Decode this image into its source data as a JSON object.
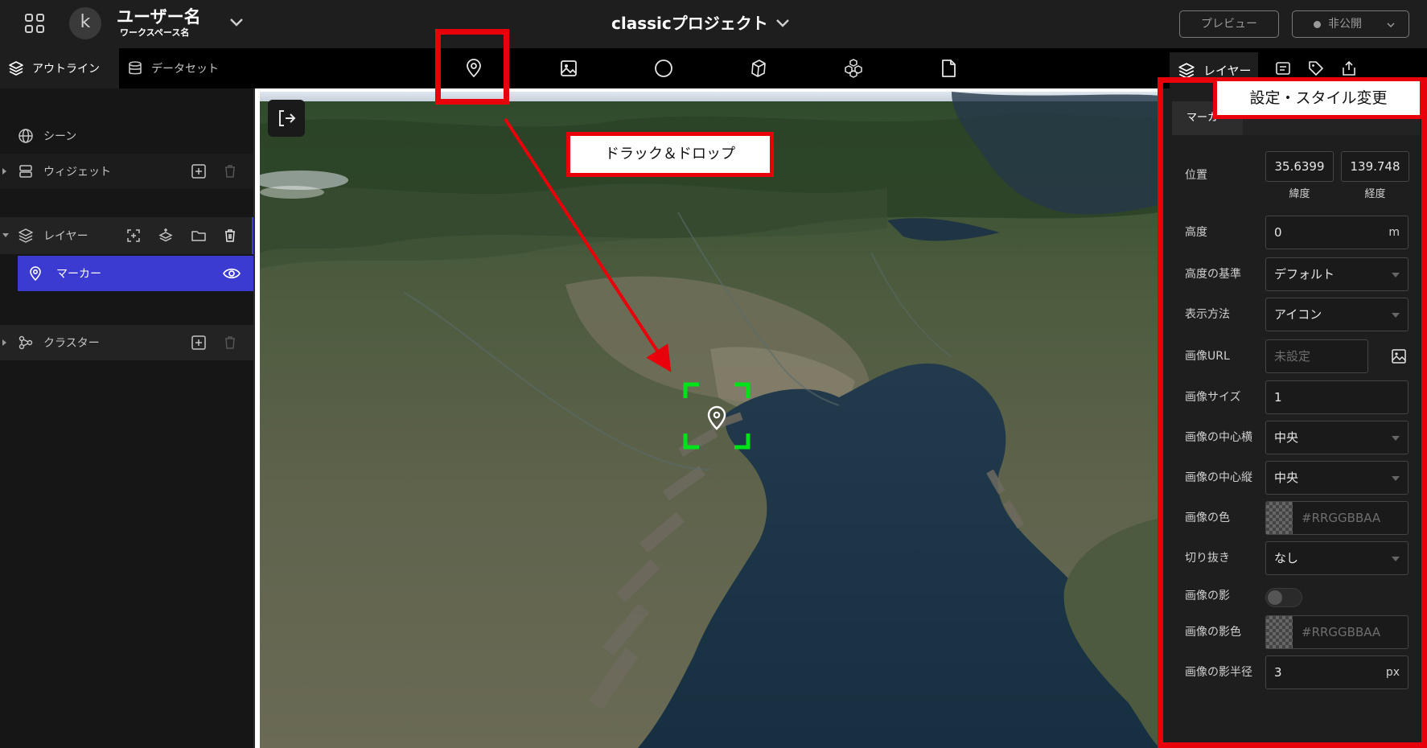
{
  "header": {
    "user_initial": "k",
    "user_name": "ユーザー名",
    "workspace_name": "ワークスペース名",
    "project_title": "classicプロジェクト",
    "preview_label": "プレビュー",
    "publish_label": "非公開"
  },
  "left_tabs": {
    "outline": "アウトライン",
    "dataset": "データセット"
  },
  "outline": {
    "scene": "シーン",
    "widget": "ウィジェット",
    "layer": "レイヤー",
    "marker": "マーカー",
    "cluster": "クラスター"
  },
  "toolbar": {
    "icons": [
      "map-pin-icon",
      "image-icon",
      "circle-icon",
      "box-icon",
      "boxes-icon",
      "file-icon"
    ]
  },
  "right_panel": {
    "tab_layer": "レイヤー",
    "sub_tab": "マーカー",
    "properties": {
      "position_label": "位置",
      "latitude": "35.6399",
      "longitude": "139.748",
      "latitude_label": "緯度",
      "longitude_label": "経度",
      "height_label": "高度",
      "height_value": "0",
      "height_unit": "m",
      "height_ref_label": "高度の基準",
      "height_ref_value": "デフォルト",
      "display_label": "表示方法",
      "display_value": "アイコン",
      "image_url_label": "画像URL",
      "image_url_placeholder": "未設定",
      "image_size_label": "画像サイズ",
      "image_size_value": "1",
      "image_center_x_label": "画像の中心横",
      "image_center_x_value": "中央",
      "image_center_y_label": "画像の中心縦",
      "image_center_y_value": "中央",
      "image_color_label": "画像の色",
      "image_color_placeholder": "#RRGGBBAA",
      "crop_label": "切り抜き",
      "crop_value": "なし",
      "shadow_label": "画像の影",
      "shadow_enabled": false,
      "shadow_color_label": "画像の影色",
      "shadow_color_placeholder": "#RRGGBBAA",
      "shadow_radius_label": "画像の影半径",
      "shadow_radius_value": "3",
      "shadow_radius_unit": "px"
    }
  },
  "annotations": {
    "drag_drop": "ドラック＆ドロップ",
    "settings": "設定・スタイル変更",
    "color": "#e8000b"
  }
}
